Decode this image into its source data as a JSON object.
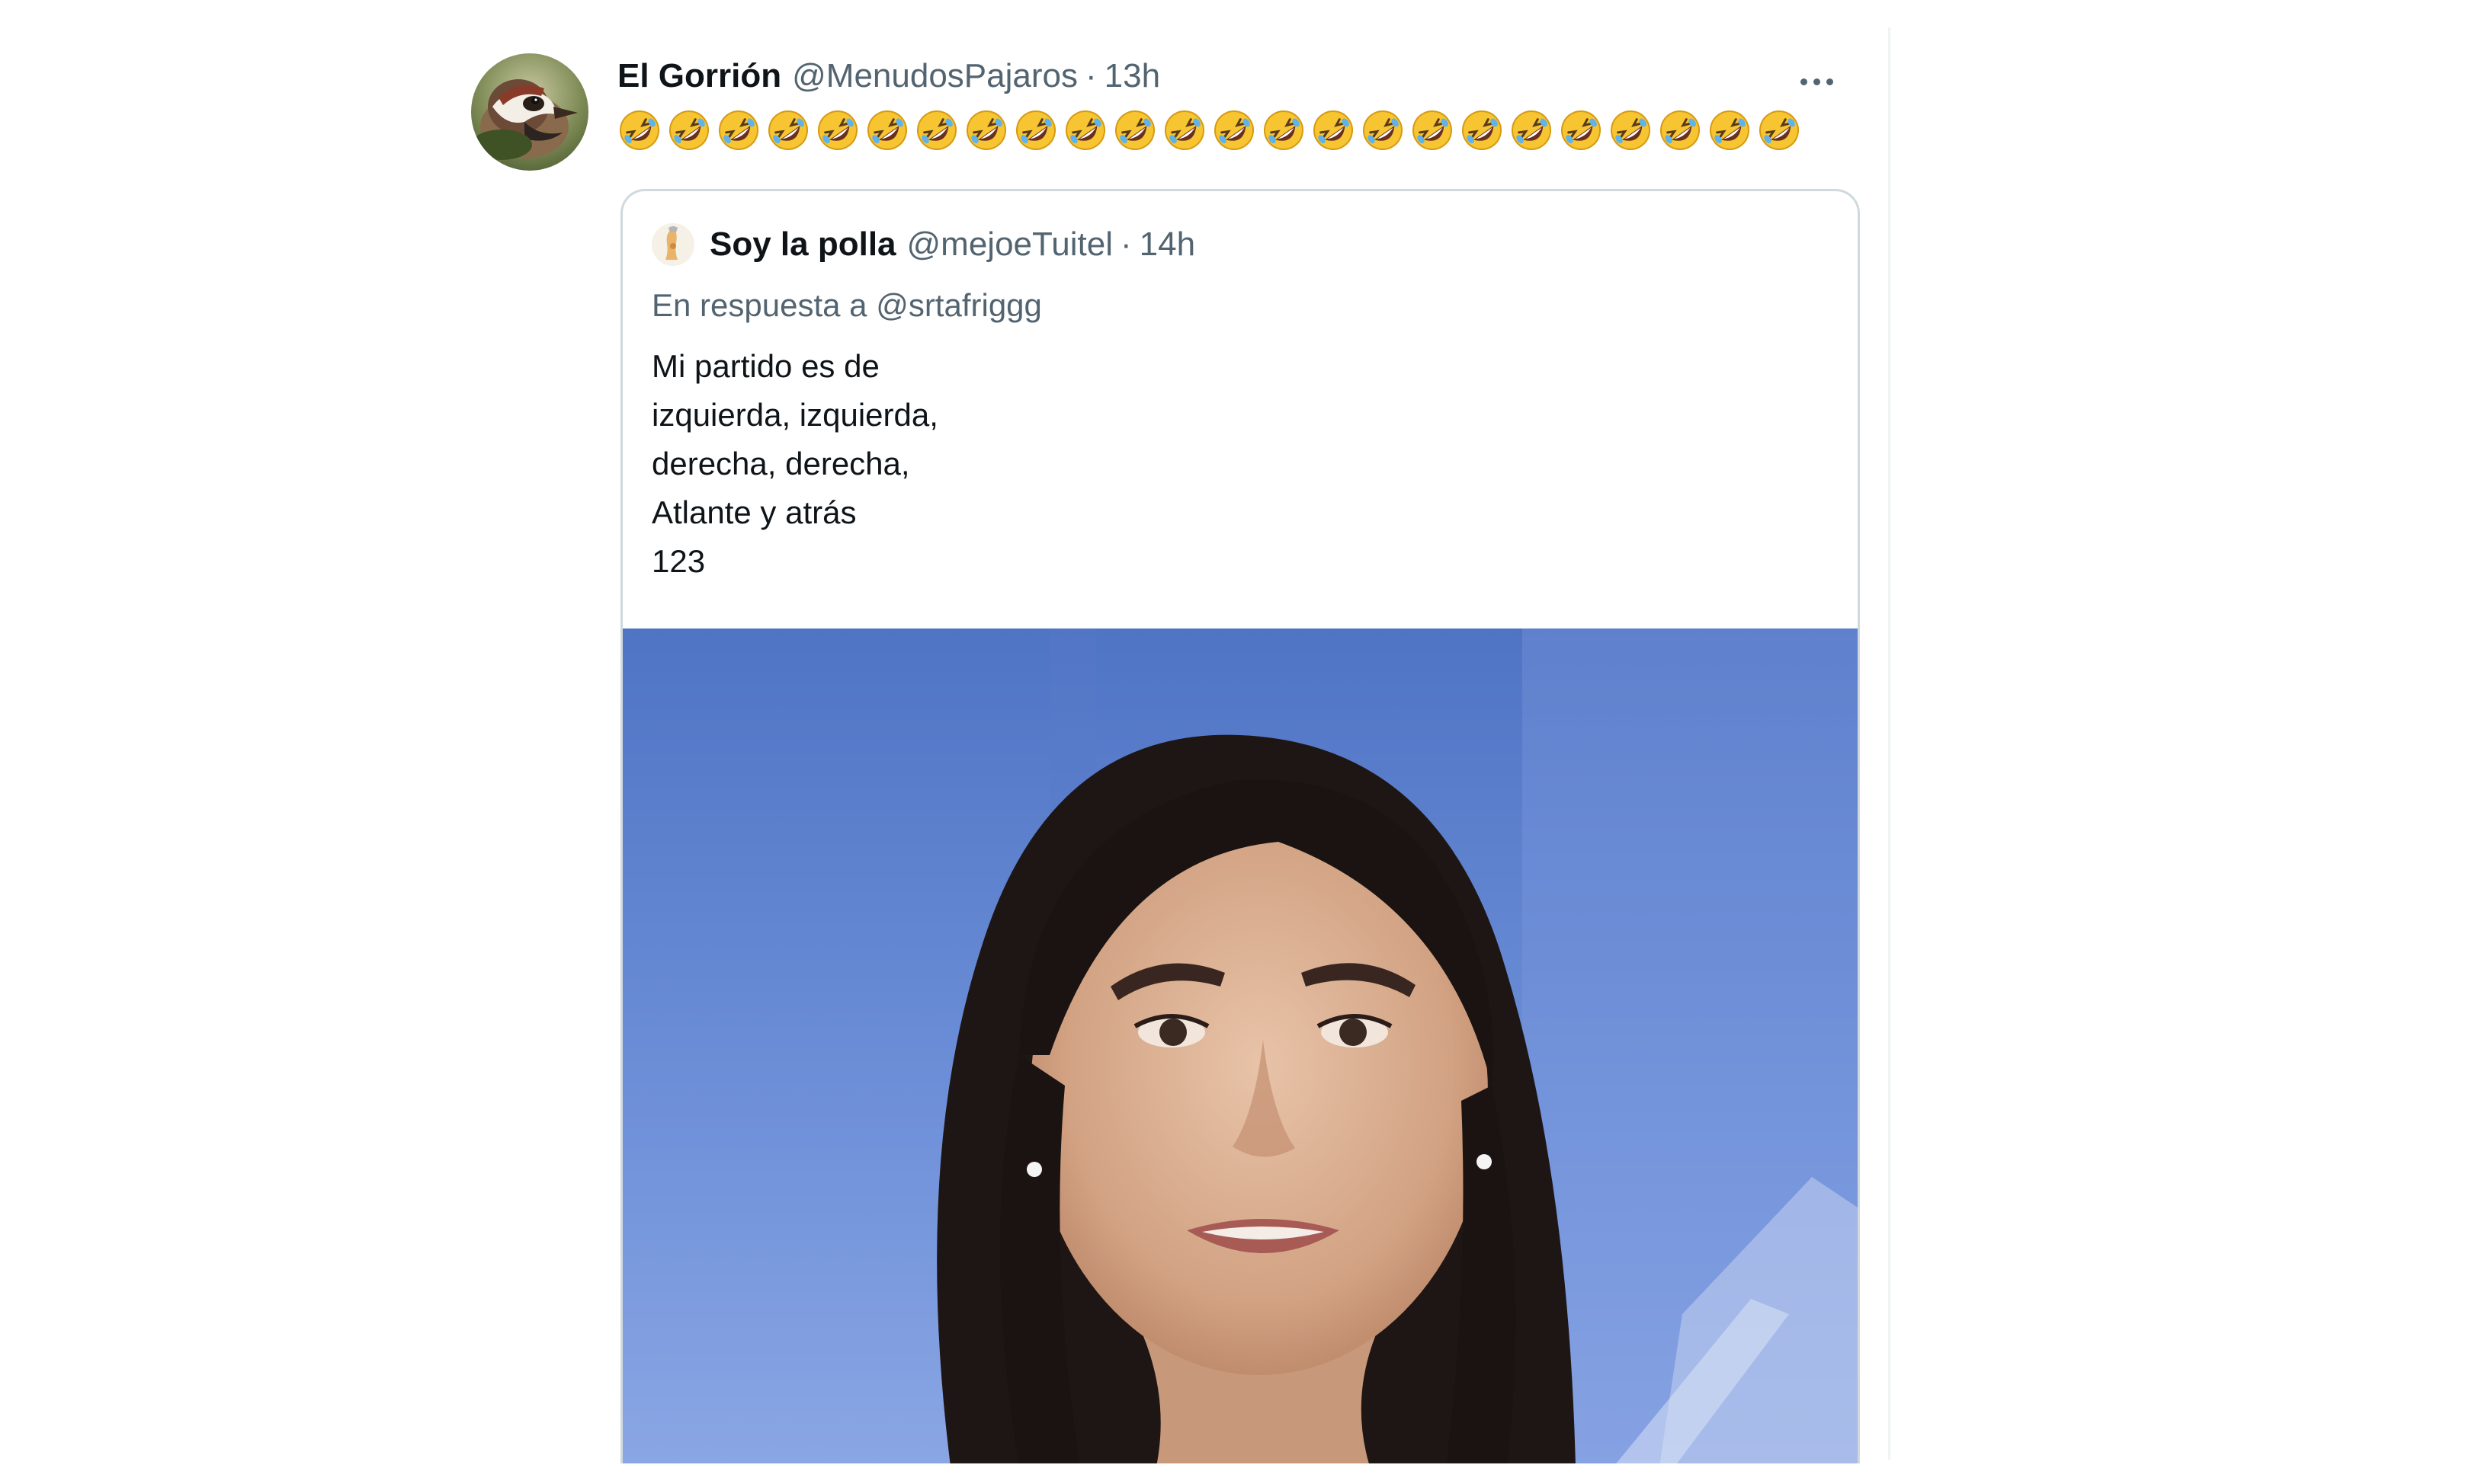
{
  "tweet": {
    "author_name": "El Gorrión",
    "author_handle": "@MenudosPajaros",
    "separator": "·",
    "timestamp": "13h",
    "text": "🤣🤣🤣🤣🤣🤣🤣🤣🤣🤣🤣🤣🤣🤣🤣🤣🤣🤣🤣🤣🤣🤣🤣🤣",
    "avatar_icon": "sparrow-avatar-icon",
    "more_icon": "more-options-icon"
  },
  "quoted_tweet": {
    "author_name": "Soy la polla",
    "author_handle": "@mejoeTuitel",
    "separator": "·",
    "timestamp": "14h",
    "reply_prefix": "En respuesta a",
    "reply_to": "@srtafriggg",
    "text_lines": [
      "Mi partido es de",
      "izquierda, izquierda,",
      "derecha, derecha,",
      "Atlante y atrás",
      "123"
    ],
    "media": "photo of a smiling woman with long dark hair in front of a blue background"
  },
  "colors": {
    "primary_text": "#0f1419",
    "secondary_text": "#536471",
    "border": "#cfd9de",
    "media_background": "#5b7fce"
  }
}
